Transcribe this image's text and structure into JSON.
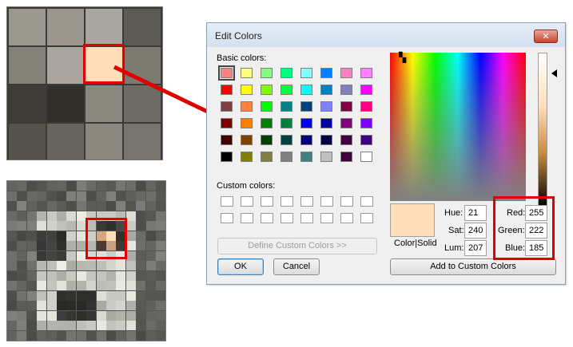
{
  "dialog": {
    "title": "Edit Colors",
    "close_glyph": "✕",
    "basic_colors_label": "Basic colors:",
    "custom_colors_label": "Custom colors:",
    "define_button": "Define Custom Colors >>",
    "ok_button": "OK",
    "cancel_button": "Cancel",
    "color_solid_label": "Color|Solid",
    "add_button": "Add to Custom Colors",
    "hue_label": "Hue:",
    "sat_label": "Sat:",
    "lum_label": "Lum:",
    "red_label": "Red:",
    "green_label": "Green:",
    "blue_label": "Blue:",
    "hue": "21",
    "sat": "240",
    "lum": "207",
    "red": "255",
    "green": "222",
    "blue": "185",
    "selected_color": "#ffdeb9"
  },
  "basic_colors": [
    [
      "#ff8080",
      "#ffff80",
      "#80ff80",
      "#00ff80",
      "#80ffff",
      "#0080ff",
      "#ff80c0",
      "#ff80ff"
    ],
    [
      "#ff0000",
      "#ffff00",
      "#80ff00",
      "#00ff40",
      "#00ffff",
      "#0080c0",
      "#8080c0",
      "#ff00ff"
    ],
    [
      "#804040",
      "#ff8040",
      "#00ff00",
      "#008080",
      "#004080",
      "#8080ff",
      "#800040",
      "#ff0080"
    ],
    [
      "#800000",
      "#ff8000",
      "#008000",
      "#008040",
      "#0000ff",
      "#0000a0",
      "#800080",
      "#8000ff"
    ],
    [
      "#400000",
      "#804000",
      "#004000",
      "#004040",
      "#000080",
      "#000040",
      "#400040",
      "#400080"
    ],
    [
      "#000000",
      "#808000",
      "#808040",
      "#808080",
      "#408080",
      "#c0c0c0",
      "#400040",
      "#ffffff"
    ]
  ],
  "accent_color": "#e10000"
}
